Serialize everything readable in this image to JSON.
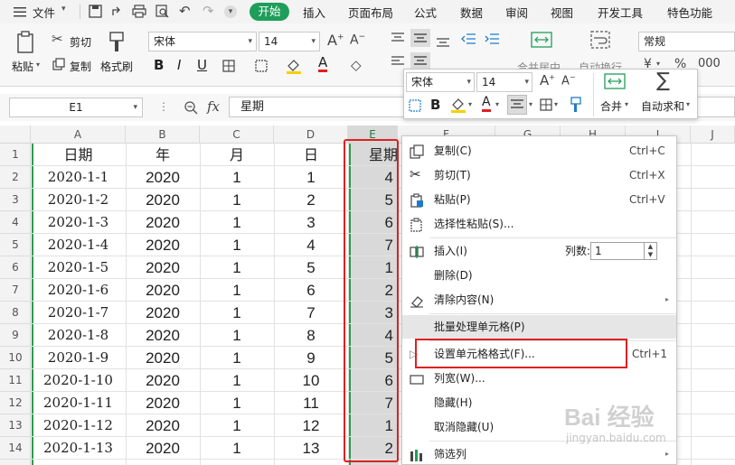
{
  "menubar": {
    "file_menu": "文件",
    "tabs": [
      "开始",
      "插入",
      "页面布局",
      "公式",
      "数据",
      "审阅",
      "视图",
      "开发工具",
      "特色功能"
    ]
  },
  "ribbon": {
    "paste": "粘贴",
    "cut": "剪切",
    "copy": "复制",
    "format_painter": "格式刷",
    "font_name": "宋体",
    "font_size": "14",
    "merge_center": "合并居中",
    "auto_wrap": "自动换行",
    "number_format": "常规",
    "percent": "%"
  },
  "formula_bar": {
    "name_box": "E1",
    "fx_label": "fx",
    "content": "星期"
  },
  "sheet": {
    "columns": [
      "A",
      "B",
      "C",
      "D",
      "E",
      "F",
      "G",
      "H",
      "I",
      "J"
    ],
    "row_numbers": [
      "1",
      "2",
      "3",
      "4",
      "5",
      "6",
      "7",
      "8",
      "9",
      "10",
      "11",
      "12",
      "13",
      "14"
    ],
    "header": {
      "a": "日期",
      "b": "年",
      "c": "月",
      "d": "日",
      "e": "星期"
    },
    "rows": [
      {
        "a": "2020-1-1",
        "b": "2020",
        "c": "1",
        "d": "1",
        "e": "4"
      },
      {
        "a": "2020-1-2",
        "b": "2020",
        "c": "1",
        "d": "2",
        "e": "5"
      },
      {
        "a": "2020-1-3",
        "b": "2020",
        "c": "1",
        "d": "3",
        "e": "6"
      },
      {
        "a": "2020-1-4",
        "b": "2020",
        "c": "1",
        "d": "4",
        "e": "7"
      },
      {
        "a": "2020-1-5",
        "b": "2020",
        "c": "1",
        "d": "5",
        "e": "1"
      },
      {
        "a": "2020-1-6",
        "b": "2020",
        "c": "1",
        "d": "6",
        "e": "2"
      },
      {
        "a": "2020-1-7",
        "b": "2020",
        "c": "1",
        "d": "7",
        "e": "3"
      },
      {
        "a": "2020-1-8",
        "b": "2020",
        "c": "1",
        "d": "8",
        "e": "4"
      },
      {
        "a": "2020-1-9",
        "b": "2020",
        "c": "1",
        "d": "9",
        "e": "5"
      },
      {
        "a": "2020-1-10",
        "b": "2020",
        "c": "1",
        "d": "10",
        "e": "6"
      },
      {
        "a": "2020-1-11",
        "b": "2020",
        "c": "1",
        "d": "11",
        "e": "7"
      },
      {
        "a": "2020-1-12",
        "b": "2020",
        "c": "1",
        "d": "12",
        "e": "1"
      },
      {
        "a": "2020-1-13",
        "b": "2020",
        "c": "1",
        "d": "13",
        "e": "2"
      }
    ]
  },
  "mini_toolbar": {
    "font_name": "宋体",
    "font_size": "14",
    "merge": "合并",
    "autosum": "自动求和"
  },
  "context_menu": {
    "copy": {
      "label": "复制(C)",
      "shortcut": "Ctrl+C"
    },
    "cut": {
      "label": "剪切(T)",
      "shortcut": "Ctrl+X"
    },
    "paste": {
      "label": "粘贴(P)",
      "shortcut": "Ctrl+V"
    },
    "paste_special": {
      "label": "选择性粘贴(S)..."
    },
    "insert": {
      "label": "插入(I)",
      "count_label": "列数:",
      "count_value": "1"
    },
    "delete": {
      "label": "删除(D)"
    },
    "clear": {
      "label": "清除内容(N)"
    },
    "batch": {
      "label": "批量处理单元格(P)"
    },
    "format_cells": {
      "label": "设置单元格格式(F)...",
      "shortcut": "Ctrl+1"
    },
    "column_width": {
      "label": "列宽(W)..."
    },
    "hide": {
      "label": "隐藏(H)"
    },
    "unhide": {
      "label": "取消隐藏(U)"
    },
    "filter_column": {
      "label": "筛选列"
    }
  },
  "watermark": {
    "logo": "Bai 经验",
    "url": "jingyan.baidu.com"
  },
  "colors": {
    "accent": "#1e9e5a",
    "highlight": "#e02020",
    "selection": "#d9d9d9"
  }
}
